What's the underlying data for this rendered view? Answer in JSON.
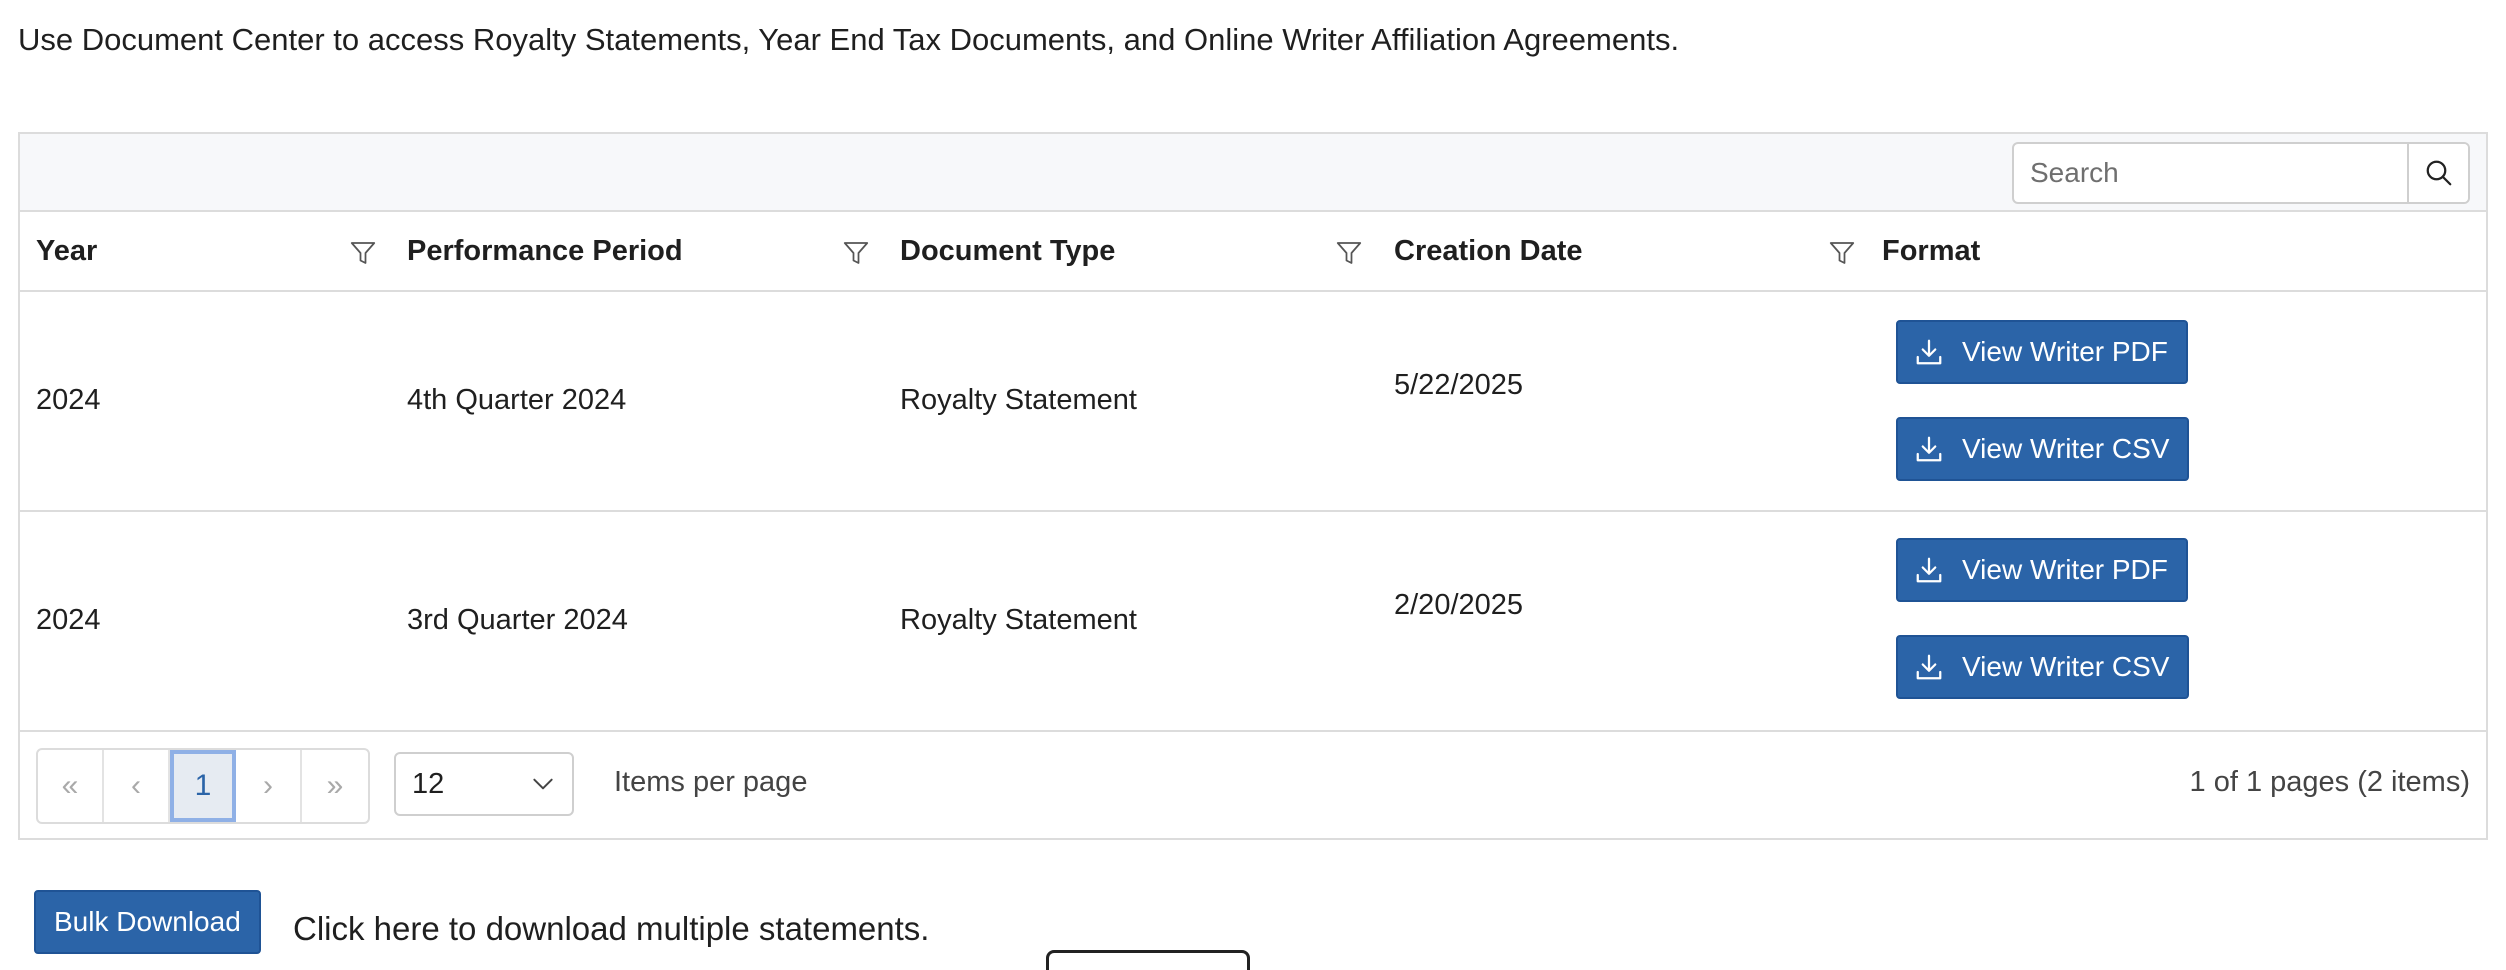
{
  "intro_text": "Use Document Center to access Royalty Statements, Year End Tax Documents, and Online Writer Affiliation Agreements.",
  "search": {
    "placeholder": "Search",
    "icon": "search-icon"
  },
  "columns": [
    {
      "label": "Year",
      "filter_icon": "filter-icon"
    },
    {
      "label": "Performance Period",
      "filter_icon": "filter-icon"
    },
    {
      "label": "Document Type",
      "filter_icon": "filter-icon"
    },
    {
      "label": "Creation Date",
      "filter_icon": "filter-icon"
    },
    {
      "label": "Format"
    }
  ],
  "rows": [
    {
      "year": "2024",
      "period": "4th Quarter 2024",
      "doc_type": "Royalty Statement",
      "created": "5/22/2025",
      "pdf_label": "View Writer PDF",
      "csv_label": "View Writer CSV"
    },
    {
      "year": "2024",
      "period": "3rd Quarter 2024",
      "doc_type": "Royalty Statement",
      "created": "2/20/2025",
      "pdf_label": "View Writer PDF",
      "csv_label": "View Writer CSV"
    }
  ],
  "pager": {
    "first": "«",
    "prev": "‹",
    "current": "1",
    "next": "›",
    "last": "»",
    "per_page_value": "12",
    "per_page_label": "Items per page",
    "info": "1 of 1 pages (2 items)"
  },
  "bulk": {
    "button_label": "Bulk Download",
    "text": "Click here to download multiple statements."
  },
  "colors": {
    "accent": "#2b64a8",
    "border": "#dcdcdc",
    "toolbar_bg": "#f7f8fa"
  }
}
